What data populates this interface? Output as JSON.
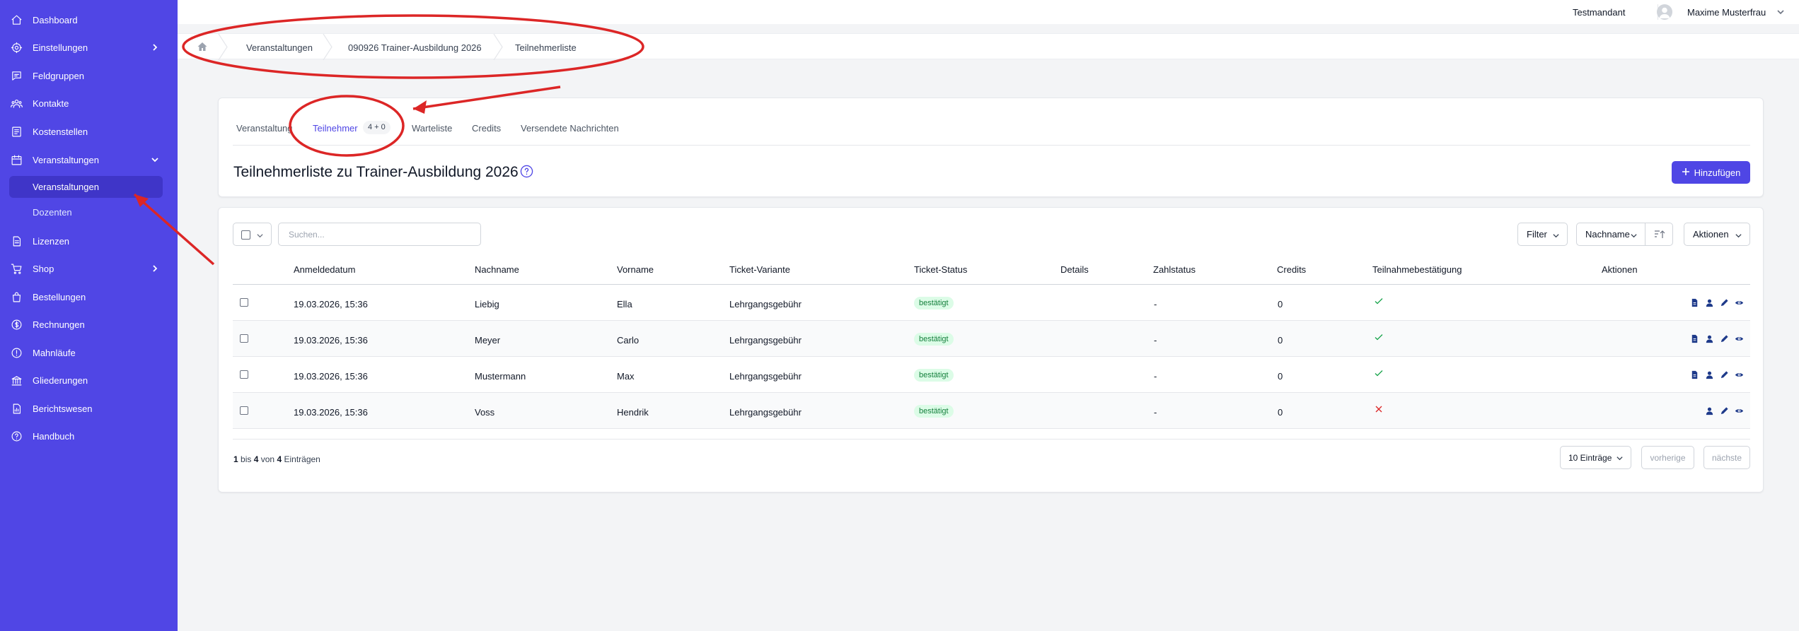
{
  "sidebar": {
    "items": [
      {
        "label": "Dashboard",
        "icon": "home-icon"
      },
      {
        "label": "Einstellungen",
        "icon": "gear-icon"
      },
      {
        "label": "Feldgruppen",
        "icon": "chat-icon"
      },
      {
        "label": "Kontakte",
        "icon": "users-icon"
      },
      {
        "label": "Kostenstellen",
        "icon": "ledger-icon"
      },
      {
        "label": "Veranstaltungen",
        "icon": "calendar-icon"
      },
      {
        "label": "Veranstaltungen"
      },
      {
        "label": "Dozenten"
      },
      {
        "label": "Lizenzen",
        "icon": "document-icon"
      },
      {
        "label": "Shop",
        "icon": "cart-icon"
      },
      {
        "label": "Bestellungen",
        "icon": "bag-icon"
      },
      {
        "label": "Rechnungen",
        "icon": "dollar-icon"
      },
      {
        "label": "Mahnläufe",
        "icon": "alert-icon"
      },
      {
        "label": "Gliederungen",
        "icon": "bank-icon"
      },
      {
        "label": "Berichtswesen",
        "icon": "report-icon"
      },
      {
        "label": "Handbuch",
        "icon": "help-icon"
      }
    ]
  },
  "topbar": {
    "tenant": "Testmandant",
    "user": "Maxime Musterfrau"
  },
  "breadcrumb": [
    "Veranstaltungen",
    "090926 Trainer-Ausbildung 2026",
    "Teilnehmerliste"
  ],
  "tabs": {
    "items": [
      "Veranstaltung",
      "Teilnehmer",
      "Warteliste",
      "Credits",
      "Versendete Nachrichten"
    ],
    "badge": "4 + 0",
    "active": "Teilnehmer"
  },
  "page": {
    "title": "Teilnehmerliste zu Trainer-Ausbildung 2026",
    "add_label": "Hinzufügen"
  },
  "toolbar": {
    "search_placeholder": "Suchen...",
    "filter": "Filter",
    "sort": "Nachname",
    "actions": "Aktionen"
  },
  "table": {
    "headers": [
      "Anmeldedatum",
      "Nachname",
      "Vorname",
      "Ticket-Variante",
      "Ticket-Status",
      "Details",
      "Zahlstatus",
      "Credits",
      "Teilnahmebestätigung",
      "Aktionen"
    ],
    "rows": [
      {
        "date": "19.03.2026, 15:36",
        "last": "Liebig",
        "first": "Ella",
        "variant": "Lehrgangsgebühr",
        "status": "bestätigt",
        "pay": "-",
        "credits": "0",
        "confirmed": true
      },
      {
        "date": "19.03.2026, 15:36",
        "last": "Meyer",
        "first": "Carlo",
        "variant": "Lehrgangsgebühr",
        "status": "bestätigt",
        "pay": "-",
        "credits": "0",
        "confirmed": true
      },
      {
        "date": "19.03.2026, 15:36",
        "last": "Mustermann",
        "first": "Max",
        "variant": "Lehrgangsgebühr",
        "status": "bestätigt",
        "pay": "-",
        "credits": "0",
        "confirmed": true
      },
      {
        "date": "19.03.2026, 15:36",
        "last": "Voss",
        "first": "Hendrik",
        "variant": "Lehrgangsgebühr",
        "status": "bestätigt",
        "pay": "-",
        "credits": "0",
        "confirmed": false
      }
    ]
  },
  "footer": {
    "from": "1",
    "bis": "bis",
    "to": "4",
    "von": "von",
    "total": "4",
    "entries": "Einträgen",
    "page_size": "10 Einträge",
    "prev": "vorherige",
    "next": "nächste"
  },
  "colors": {
    "sidebar": "#5046e5",
    "accent": "#4f46e5",
    "annotation": "#dc2626",
    "badge_bg": "#dcfce7",
    "badge_fg": "#15803d"
  }
}
